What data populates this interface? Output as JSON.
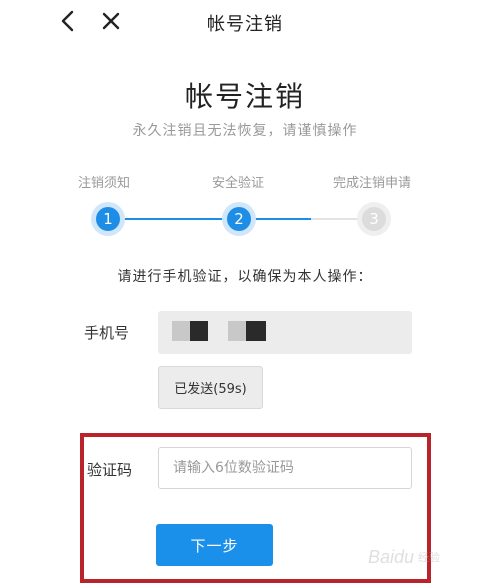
{
  "header": {
    "title": "帐号注销",
    "back_icon": "chevron-left-icon",
    "close_icon": "close-icon"
  },
  "main": {
    "title": "帐号注销",
    "subtitle": "永久注销且无法恢复，请谨慎操作"
  },
  "steps": [
    {
      "label": "注销须知",
      "number": "1",
      "state": "active"
    },
    {
      "label": "安全验证",
      "number": "2",
      "state": "active"
    },
    {
      "label": "完成注销申请",
      "number": "3",
      "state": "inactive"
    }
  ],
  "instruction": "请进行手机验证，以确保为本人操作：",
  "phone": {
    "label": "手机号"
  },
  "send_button": {
    "label": "已发送(59s)"
  },
  "code": {
    "label": "验证码",
    "placeholder": "请输入6位数验证码",
    "value": ""
  },
  "next_button": {
    "label": "下一步"
  },
  "watermark": {
    "text": "Baidu",
    "sub": "经验"
  },
  "colors": {
    "accent": "#1e8de6",
    "highlight_border": "#b8242a"
  }
}
